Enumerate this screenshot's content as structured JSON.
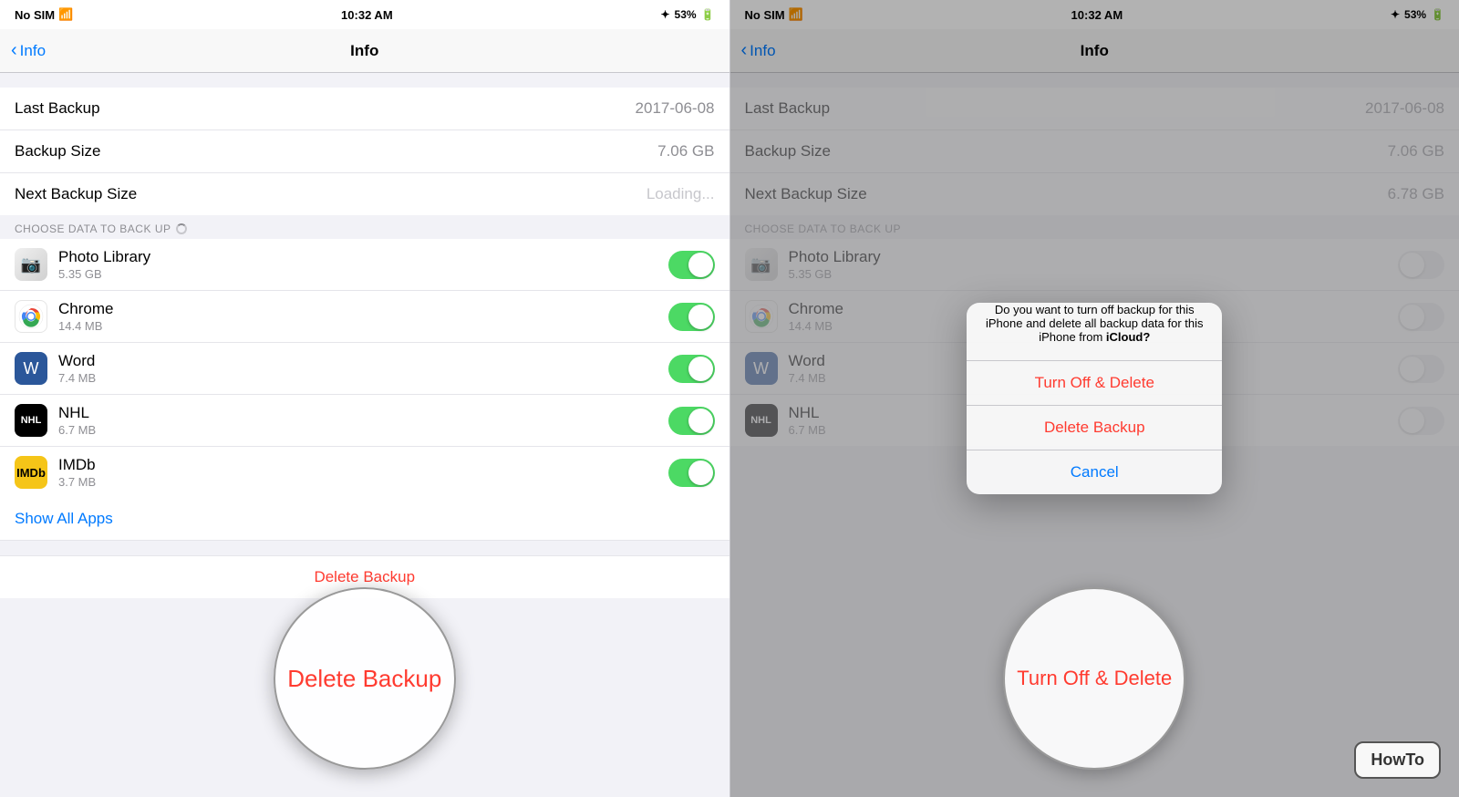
{
  "left": {
    "statusBar": {
      "carrier": "No SIM",
      "wifi": "wifi",
      "time": "10:32 AM",
      "bluetooth": "53%",
      "battery": "53%"
    },
    "navBar": {
      "backLabel": "Info",
      "title": "Info"
    },
    "infoRows": [
      {
        "label": "Last Backup",
        "value": "2017-06-08"
      },
      {
        "label": "Backup Size",
        "value": "7.06 GB"
      },
      {
        "label": "Next Backup Size",
        "value": "Loading...",
        "loading": true
      }
    ],
    "sectionHeader": "CHOOSE DATA TO BACK UP",
    "apps": [
      {
        "name": "Photo Library",
        "size": "5.35 GB",
        "icon": "photos",
        "enabled": true
      },
      {
        "name": "Chrome",
        "size": "14.4 MB",
        "icon": "chrome",
        "enabled": true
      },
      {
        "name": "Word",
        "size": "7.4 MB",
        "icon": "word",
        "enabled": true
      },
      {
        "name": "NHL",
        "size": "6.7 MB",
        "icon": "nhl",
        "enabled": true
      },
      {
        "name": "IMDb",
        "size": "3.7 MB",
        "icon": "imdb",
        "enabled": true
      }
    ],
    "showAllLabel": "Show All Apps",
    "deleteLabel": "Delete Backup",
    "magnifier": {
      "text": "Delete Backup"
    }
  },
  "right": {
    "statusBar": {
      "carrier": "No SIM",
      "wifi": "wifi",
      "time": "10:32 AM",
      "bluetooth": "53%",
      "battery": "53%"
    },
    "navBar": {
      "backLabel": "Info",
      "title": "Info"
    },
    "infoRows": [
      {
        "label": "Last Backup",
        "value": "2017-06-08"
      },
      {
        "label": "Backup Size",
        "value": "7.06 GB"
      },
      {
        "label": "Next Backup Size",
        "value": "6.78 GB"
      }
    ],
    "sectionHeader": "CHOOSE DATA TO BACK UP",
    "apps": [
      {
        "name": "Photo Library",
        "size": "5.35 GB",
        "icon": "photos",
        "enabled": true
      },
      {
        "name": "Chrome",
        "size": "14.4 MB",
        "icon": "chrome",
        "enabled": true
      },
      {
        "name": "Word",
        "size": "7.4 MB",
        "icon": "word",
        "enabled": true
      },
      {
        "name": "NHL",
        "size": "6.7 MB",
        "icon": "nhl",
        "enabled": true
      }
    ],
    "dialog": {
      "message": "Do you want to turn off iCloud backup for this iPhone and delete all backup data for this iPhone from iCloud?",
      "titleHighlight": "iCloud?",
      "buttons": [
        {
          "label": "Turn Off & Delete",
          "type": "destructive"
        },
        {
          "label": "Delete Backup",
          "type": "delete-red"
        },
        {
          "label": "Cancel",
          "type": "cancel"
        }
      ]
    },
    "magnifier": {
      "text": "Turn Off & Delete"
    }
  },
  "howto": {
    "label": "HowTo"
  }
}
